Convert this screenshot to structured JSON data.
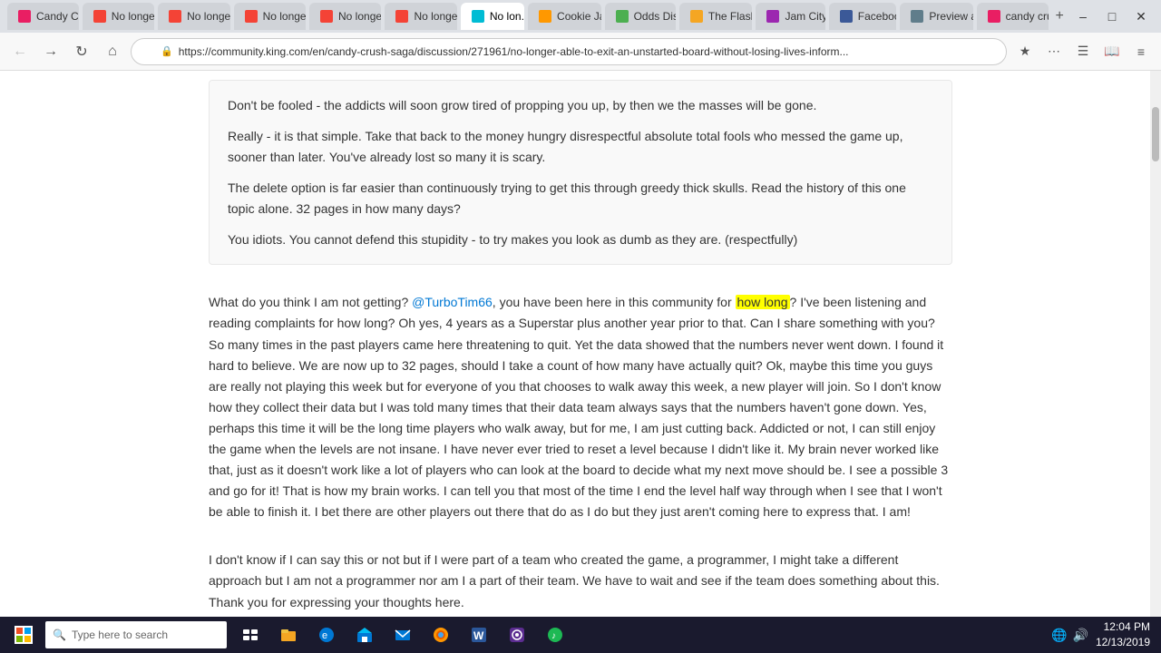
{
  "browser": {
    "tabs": [
      {
        "id": "tab1",
        "label": "Candy Cr...",
        "favicon_class": "fav-candy",
        "active": false
      },
      {
        "id": "tab2",
        "label": "No longer...",
        "favicon_class": "fav-no",
        "active": false
      },
      {
        "id": "tab3",
        "label": "No longer...",
        "favicon_class": "fav-no",
        "active": false
      },
      {
        "id": "tab4",
        "label": "No longer...",
        "favicon_class": "fav-no",
        "active": false
      },
      {
        "id": "tab5",
        "label": "No longer...",
        "favicon_class": "fav-no",
        "active": false
      },
      {
        "id": "tab6",
        "label": "No longer...",
        "favicon_class": "fav-no",
        "active": false
      },
      {
        "id": "tab7",
        "label": "No lon...",
        "favicon_class": "fav-king",
        "active": true
      },
      {
        "id": "tab8",
        "label": "Cookie Ja...",
        "favicon_class": "fav-cookie",
        "active": false
      },
      {
        "id": "tab9",
        "label": "Odds Dis...",
        "favicon_class": "fav-odds",
        "active": false
      },
      {
        "id": "tab10",
        "label": "The Flash...",
        "favicon_class": "fav-flash",
        "active": false
      },
      {
        "id": "tab11",
        "label": "Jam City...",
        "favicon_class": "fav-jam",
        "active": false
      },
      {
        "id": "tab12",
        "label": "Facebook",
        "favicon_class": "fav-fb",
        "active": false
      },
      {
        "id": "tab13",
        "label": "Preview a...",
        "favicon_class": "fav-preview",
        "active": false
      },
      {
        "id": "tab14",
        "label": "candy cru...",
        "favicon_class": "fav-candy",
        "active": false
      }
    ],
    "url": "https://community.king.com/en/candy-crush-saga/discussion/271961/no-longer-able-to-exit-an-unstarted-board-without-losing-lives-inform...",
    "time": "12:04 PM",
    "date": "12/13/2019"
  },
  "post1": {
    "lines": [
      "Don't be fooled - the addicts will soon grow tired of propping you up, by then we the masses will be gone.",
      "Really - it is that simple. Take that back to the money hungry disrespectful absolute total fools who messed the game up, sooner than later. You've already lost so many it is scary.",
      "The delete option is far easier than continuously trying to get this through greedy thick skulls. Read the history of this one topic alone. 32 pages in how many days?",
      "You idiots. You cannot defend this stupidity - to try makes you look as dumb as they are. (respectfully)"
    ]
  },
  "post2": {
    "mention": "@TurboTim66",
    "text_before": "What do you think I am not getting? ",
    "text_after": ", you have been here in this community for how long?  I've been listening and reading complaints for how long?  Oh yes, 4 years as a Superstar plus another year prior to that.  Can I share something with you?  So many times in the past players came here threatening to quit.  Yet the data showed that the numbers never went down.  I found it hard to believe.  We are now up to 32 pages, should I take a count of how many have actually quit?  Ok, maybe this time you guys are really not playing this week but for everyone of you that chooses to walk away this week, a new player will join.  So I don't know how they collect their data but I was told many times that their data team always says that the numbers haven't gone down.  Yes, perhaps this time it will be the long time players who walk away, but for me, I am just cutting back.  Addicted or not, I can still enjoy the game when the levels are not insane.  I have never ever tried to reset a level because I didn't like it.  My brain never worked like that, just as it doesn't work like a lot of players who can look at the board to decide what my next move should be.  I see a possible 3 and go for it!  That is how my brain works.  I can tell you that most of the time I end the level half way through when I see that I won't be able to finish it.  I bet there are other players out there that do as I do but they just aren't coming here to express that.  I am!"
  },
  "post3": {
    "text": "I don't know if I can say this or not but if I were part of a team who created the game, a programmer, I might take a different approach but I am not a programmer nor am I a part of their team.  We have to wait and see if the team does something about this.  Thank you for expressing your thoughts here."
  },
  "highlight": {
    "text": "how long"
  },
  "taskbar": {
    "search_placeholder": "Type here to search",
    "time": "12:04 PM",
    "date": "12/13/2019"
  }
}
